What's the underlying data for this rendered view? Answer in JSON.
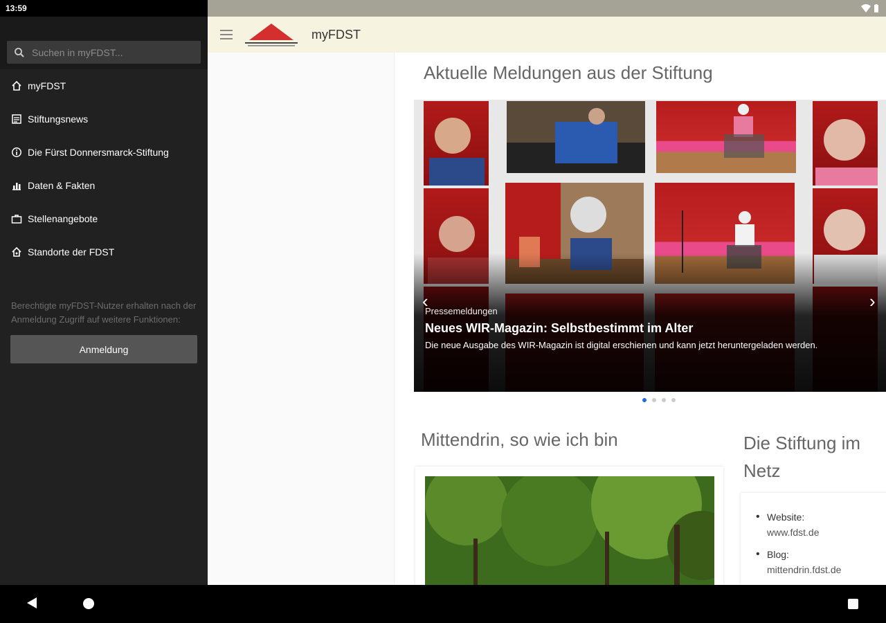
{
  "status": {
    "time": "13:59"
  },
  "app": {
    "title": "myFDST"
  },
  "search": {
    "placeholder": "Suchen in myFDST..."
  },
  "sidebar": {
    "items": [
      {
        "label": "myFDST",
        "icon": "home-icon"
      },
      {
        "label": "Stiftungsnews",
        "icon": "news-icon"
      },
      {
        "label": "Die Fürst Donnersmarck-Stiftung",
        "icon": "info-icon"
      },
      {
        "label": "Daten & Fakten",
        "icon": "bar-chart-icon"
      },
      {
        "label": "Stellenangebote",
        "icon": "briefcase-icon"
      },
      {
        "label": "Standorte der FDST",
        "icon": "location-icon"
      }
    ],
    "note": "Berechtigte myFDST-Nutzer erhalten nach der Anmeldung Zugriff auf weitere Funktionen:",
    "login_label": "Anmeldung"
  },
  "news": {
    "heading": "Aktuelle Meldungen aus der Stiftung",
    "slide": {
      "category": "Pressemeldungen",
      "title": "Neues WIR-Magazin: Selbstbestimmt im Alter",
      "description": "Die neue Ausgabe des WIR-Magazin ist digital erschienen und kann jetzt heruntergeladen werden."
    },
    "dots": 4,
    "active_dot": 0
  },
  "section2": {
    "heading": "Mittendrin, so wie ich bin"
  },
  "section3": {
    "heading": "Die Stiftung im Netz",
    "links": [
      {
        "label": "Website:",
        "url": "www.fdst.de"
      },
      {
        "label": "Blog:",
        "url": "mittendrin.fdst.de"
      }
    ]
  },
  "colors": {
    "accent": "#1e6de0",
    "header_bg": "#f7f3e1",
    "sidebar_bg": "#212121",
    "logo_red": "#d32f2f"
  }
}
